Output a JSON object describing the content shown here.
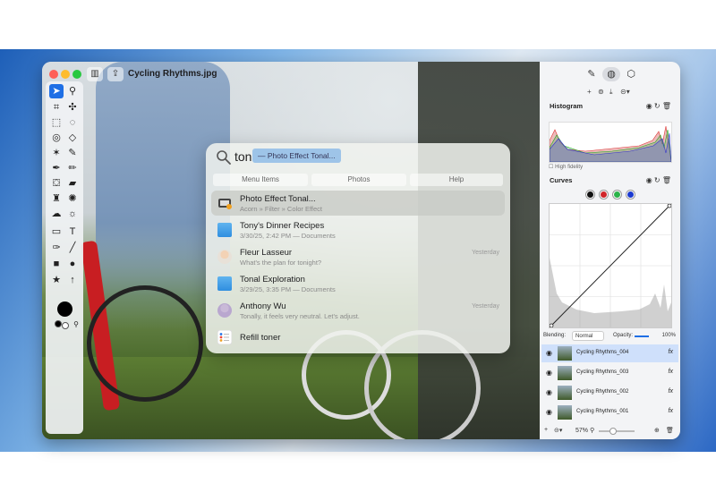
{
  "window": {
    "document_title": "Cycling Rhythms.jpg"
  },
  "search": {
    "query": "ton",
    "suggestion": "— Photo Effect Tonal...",
    "tabs": [
      "Menu Items",
      "Photos",
      "Help"
    ]
  },
  "results": [
    {
      "title": "Photo Effect Tonal...",
      "subtitle": "Acorn » Filter » Color Effect",
      "time": "",
      "icon": "filter-icon"
    },
    {
      "title": "Tony's Dinner Recipes",
      "subtitle": "3/30/25, 2:42 PM — Documents",
      "time": "",
      "icon": "folder-icon"
    },
    {
      "title": "Fleur Lasseur",
      "subtitle": "What's the plan for tonight?",
      "time": "Yesterday",
      "icon": "avatar-icon"
    },
    {
      "title": "Tonal Exploration",
      "subtitle": "3/29/25, 3:35 PM — Documents",
      "time": "",
      "icon": "folder-icon"
    },
    {
      "title": "Anthony Wu",
      "subtitle": "Tonally, it feels very neutral. Let's adjust.",
      "time": "Yesterday",
      "icon": "avatar-icon"
    },
    {
      "title": "Refill toner",
      "subtitle": "",
      "time": "",
      "icon": "reminders-icon"
    }
  ],
  "inspector": {
    "histogram_title": "Histogram",
    "high_fidelity_label": "High fidelity",
    "curves_title": "Curves",
    "blending_label": "Blending:",
    "blending_value": "Normal",
    "opacity_label": "Opacity:",
    "opacity_value": "100%",
    "layers": [
      {
        "name": "Cycling Rhythms_004",
        "fx": "fx"
      },
      {
        "name": "Cycling Rhythms_003",
        "fx": "fx"
      },
      {
        "name": "Cycling Rhythms_002",
        "fx": "fx"
      },
      {
        "name": "Cycling Rhythms_001",
        "fx": "fx"
      }
    ],
    "zoom": "57%"
  },
  "colors": {
    "accent": "#1f6fe5",
    "curve_dots": [
      "#111111",
      "#d0262a",
      "#2bb34a",
      "#1b3ad0"
    ]
  }
}
